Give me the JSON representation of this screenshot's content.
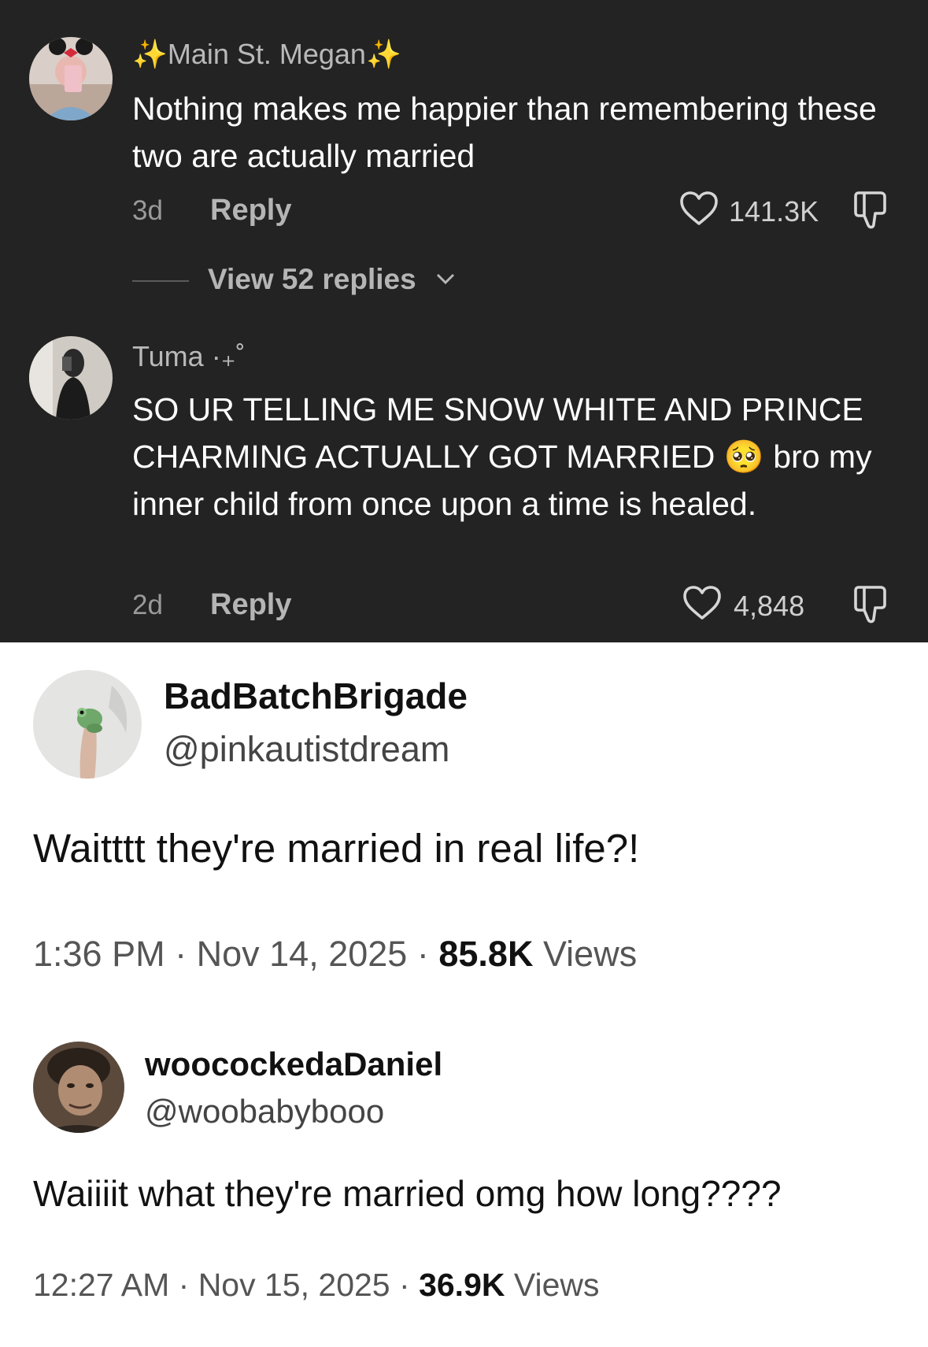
{
  "tiktok_comments": [
    {
      "username": "✨Main St. Megan✨",
      "text": "Nothing makes me happier than remembering these two are actually married",
      "age": "3d",
      "reply_label": "Reply",
      "likes": "141.3K",
      "view_replies": "View 52 replies"
    },
    {
      "username": "Tuma ·₊˚",
      "text": "SO UR TELLING ME SNOW WHITE AND PRINCE CHARMING ACTUALLY GOT MARRIED",
      "emoji": "🥺",
      "text_after_emoji": "bro my inner child from once upon a time is healed.",
      "age": "2d",
      "reply_label": "Reply",
      "likes": "4,848"
    }
  ],
  "tweets": [
    {
      "display_name": "BadBatchBrigade",
      "handle": "@pinkautistdream",
      "text": "Waitttt they're married in real life?!",
      "time": "1:36 PM",
      "date": "Nov 14, 2025",
      "views_count": "85.8K",
      "views_label": "Views"
    },
    {
      "display_name": "woocockedaDaniel",
      "handle": "@woobabybooo",
      "text": "Waiiiit what they're married omg how long????",
      "time": "12:27 AM",
      "date": "Nov 15, 2025",
      "views_count": "36.9K",
      "views_label": "Views"
    }
  ],
  "separator": "·"
}
